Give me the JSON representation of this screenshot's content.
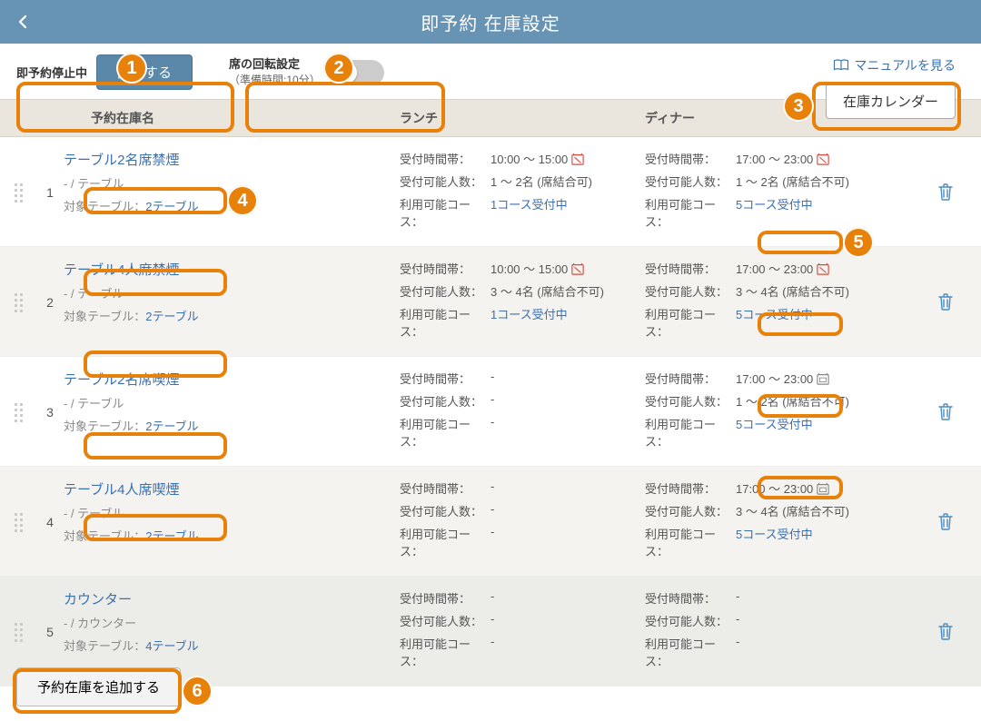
{
  "nav": {
    "title": "即予約 在庫設定"
  },
  "manual_link": "マニュアルを見る",
  "status": {
    "label": "即予約停止中",
    "start_btn": "開始する"
  },
  "rotation": {
    "title": "席の回転設定",
    "subtitle": "（準備時間:10分）"
  },
  "calendar_btn": "在庫カレンダー",
  "columns": {
    "stock": "予約在庫名",
    "lunch": "ランチ",
    "dinner": "ディナー"
  },
  "labels": {
    "time_band": "受付時間帯：",
    "capacity": "受付可能人数：",
    "courses": "利用可能コース：",
    "target_tables": "対象テーブル："
  },
  "rows": [
    {
      "idx": "1",
      "name": "テーブル2名席禁煙",
      "subtitle": "- / テーブル",
      "tables": "2テーブル",
      "lunch": {
        "time": "10:00 ～ 15:00",
        "time_icon": true,
        "capacity": "1 ～ 2名 (席結合可)",
        "courses": "1コース受付中"
      },
      "dinner": {
        "time": "17:00 ～ 23:00",
        "time_icon": true,
        "capacity": "1 ～ 2名 (席結合不可)",
        "courses": "5コース受付中"
      }
    },
    {
      "idx": "2",
      "name": "テーブル4人席禁煙",
      "subtitle": "- / テーブル",
      "tables": "2テーブル",
      "lunch": {
        "time": "10:00 ～ 15:00",
        "time_icon": true,
        "capacity": "3 ～ 4名 (席結合不可)",
        "courses": "1コース受付中"
      },
      "dinner": {
        "time": "17:00 ～ 23:00",
        "time_icon": true,
        "capacity": "3 ～ 4名 (席結合不可)",
        "courses": "5コース受付中"
      }
    },
    {
      "idx": "3",
      "name": "テーブル2名席喫煙",
      "subtitle": "- / テーブル",
      "tables": "2テーブル",
      "lunch": {
        "time": "-",
        "capacity": "-",
        "courses": "-"
      },
      "dinner": {
        "time": "17:00 ～ 23:00",
        "time_icon2": true,
        "capacity": "1 ～ 2名 (席結合不可)",
        "courses": "5コース受付中"
      }
    },
    {
      "idx": "4",
      "name": "テーブル4人席喫煙",
      "subtitle": "- / テーブル",
      "tables": "2テーブル",
      "lunch": {
        "time": "-",
        "capacity": "-",
        "courses": "-"
      },
      "dinner": {
        "time": "17:00 ～ 23:00",
        "time_icon2": true,
        "capacity": "3 ～ 4名 (席結合不可)",
        "courses": "5コース受付中"
      }
    },
    {
      "idx": "5",
      "name": "カウンター",
      "subtitle": "- / カウンター",
      "tables": "4テーブル",
      "lunch": {
        "time": "-",
        "capacity": "-",
        "courses": "-",
        "courses_label_suffix": ""
      },
      "dinner": {
        "time": "-",
        "capacity": "-",
        "courses": "-",
        "courses_label_suffix": ""
      }
    }
  ],
  "add_btn": "予約在庫を追加する",
  "callouts": {
    "c1": "1",
    "c2": "2",
    "c3": "3",
    "c4": "4",
    "c5": "5",
    "c6": "6"
  }
}
